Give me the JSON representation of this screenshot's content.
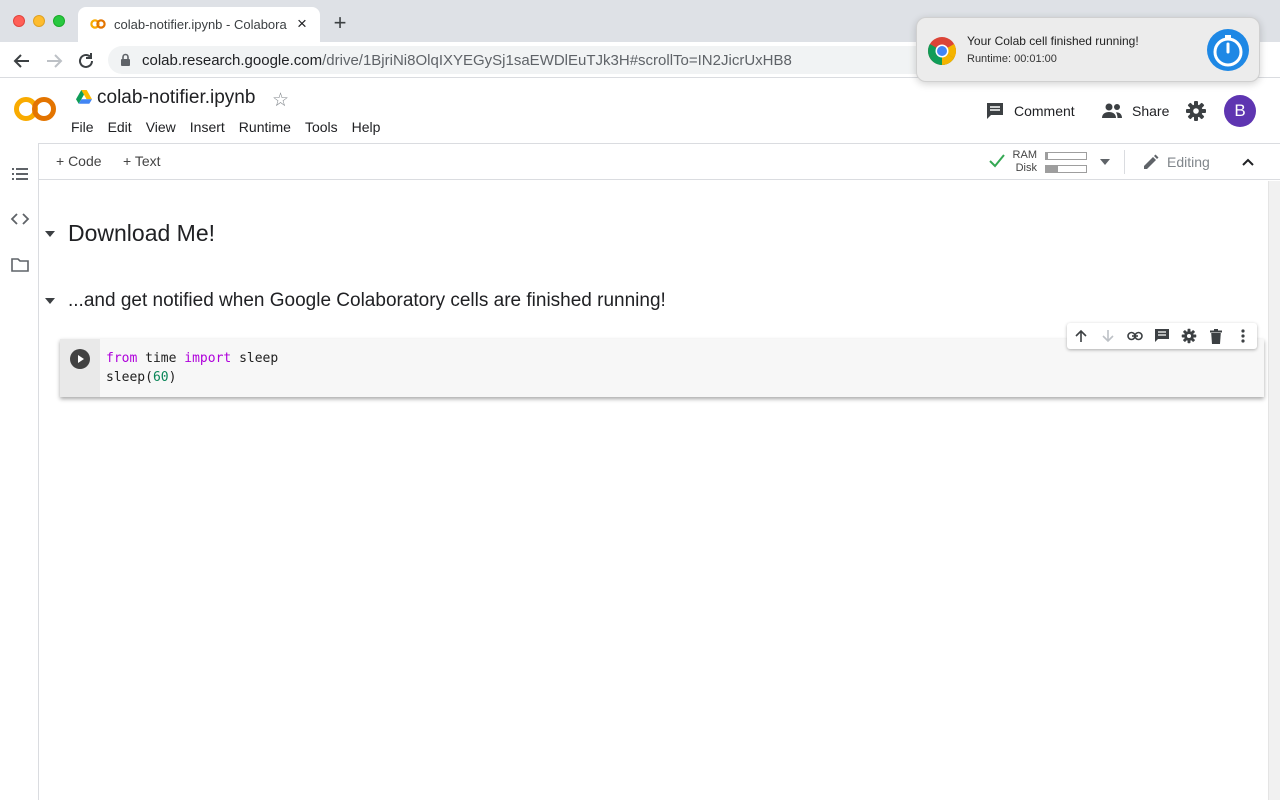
{
  "browser": {
    "tab_title": "colab-notifier.ipynb - Colabora",
    "tab_close": "×",
    "new_tab": "+",
    "url_host": "colab.research.google.com",
    "url_path": "/drive/1BjriNi8OlqIXYEGySj1saEWDlEuTJk3H#scrollTo=IN2JicrUxHB8"
  },
  "notification": {
    "title": "Your Colab cell finished running!",
    "body": "Runtime: 00:01:00"
  },
  "header": {
    "notebook_title": "colab-notifier.ipynb",
    "menu": [
      "File",
      "Edit",
      "View",
      "Insert",
      "Runtime",
      "Tools",
      "Help"
    ],
    "comment_label": "Comment",
    "share_label": "Share",
    "avatar_letter": "B"
  },
  "toolbar": {
    "add_code": "+ Code",
    "add_text": "+ Text",
    "ram_label": "RAM",
    "disk_label": "Disk",
    "ram_usage": 0.05,
    "disk_usage": 0.3,
    "editing_label": "Editing"
  },
  "notebook": {
    "heading1": "Download Me!",
    "heading2": "...and get notified when Google Colaboratory cells are finished running!",
    "code": {
      "line1": {
        "kw1": "from",
        "mod": " time ",
        "kw2": "import",
        "name": " sleep"
      },
      "line2": {
        "call": "sleep(",
        "arg": "60",
        "close": ")"
      }
    }
  },
  "colors": {
    "accent_purple": "#5e35b1",
    "keyword": "#af00db",
    "number": "#098658",
    "check_green": "#34a853",
    "timer_blue": "#1e88e5"
  }
}
